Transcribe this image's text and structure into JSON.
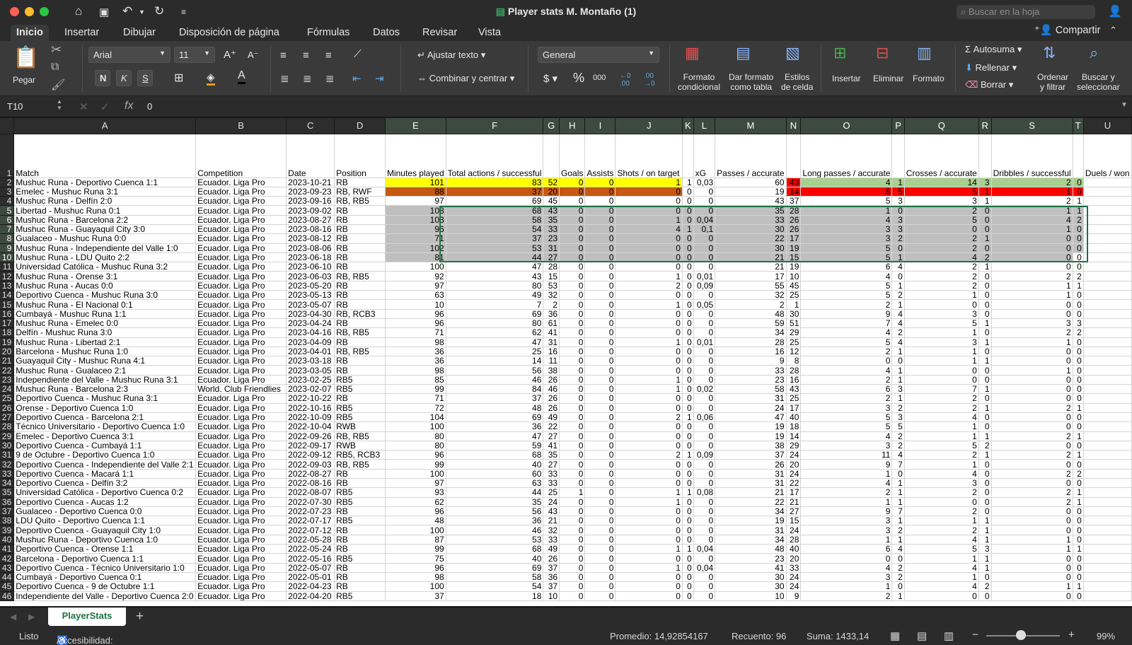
{
  "window": {
    "title": "Player stats M. Montaño (1)",
    "search_placeholder": "Buscar en la hoja"
  },
  "ribbon_tabs": [
    "Inicio",
    "Insertar",
    "Dibujar",
    "Disposición de página",
    "Fórmulas",
    "Datos",
    "Revisar",
    "Vista"
  ],
  "share": "Compartir",
  "ribbon": {
    "paste": "Pegar",
    "font": "Arial",
    "size": "11",
    "wrap": "Ajustar texto",
    "merge": "Combinar y centrar",
    "number_format": "General",
    "cond_format": [
      "Formato",
      "condicional"
    ],
    "format_table": [
      "Dar formato",
      "como tabla"
    ],
    "cell_styles": [
      "Estilos",
      "de celda"
    ],
    "insert": "Insertar",
    "delete": "Eliminar",
    "format": "Formato",
    "autosum": "Autosuma",
    "fill": "Rellenar",
    "clear": "Borrar",
    "sort": [
      "Ordenar",
      "y filtrar"
    ],
    "find": [
      "Buscar y",
      "seleccionar"
    ]
  },
  "formula_bar": {
    "cell": "T10",
    "value": "0"
  },
  "columns": [
    "A",
    "B",
    "C",
    "D",
    "E",
    "F",
    "G",
    "H",
    "I",
    "J",
    "K",
    "L",
    "M",
    "N",
    "O",
    "P",
    "Q",
    "R",
    "S",
    "T",
    "U"
  ],
  "header_row": [
    "Match",
    "Competition",
    "Date",
    "Position",
    "Minutes played",
    "Total actions / successful",
    "",
    "Goals",
    "Assists",
    "Shots / on target",
    "",
    "xG",
    "Passes / accurate",
    "",
    "Long passes / accurate",
    "",
    "Crosses / accurate",
    "",
    "Dribbles / successful",
    "",
    "Duels / won"
  ],
  "rows": [
    [
      "Mushuc Runa - Deportivo Cuenca 1:1",
      "Ecuador. Liga Pro",
      "2023-10-21",
      "RB",
      "101",
      "83",
      "52",
      "0",
      "0",
      "1",
      "1",
      "0,03",
      "60",
      "43",
      "4",
      "1",
      "14",
      "3",
      "2",
      "0"
    ],
    [
      "Emelec - Mushuc Runa 3:1",
      "Ecuador. Liga Pro",
      "2023-09-23",
      "RB, RWF",
      "88",
      "37",
      "20",
      "0",
      "0",
      "0",
      "0",
      "0",
      "19",
      "14",
      "6",
      "5",
      "5",
      "1",
      "1",
      "0"
    ],
    [
      "Mushuc Runa - Delfín 2:0",
      "Ecuador. Liga Pro",
      "2023-09-16",
      "RB, RB5",
      "97",
      "69",
      "45",
      "0",
      "0",
      "0",
      "0",
      "0",
      "43",
      "37",
      "5",
      "3",
      "3",
      "1",
      "2",
      "1"
    ],
    [
      "Libertad - Mushuc Runa 0:1",
      "Ecuador. Liga Pro",
      "2023-09-02",
      "RB",
      "108",
      "68",
      "43",
      "0",
      "0",
      "0",
      "0",
      "0",
      "35",
      "28",
      "1",
      "0",
      "2",
      "0",
      "1",
      "1"
    ],
    [
      "Mushuc Runa - Barcelona 2:2",
      "Ecuador. Liga Pro",
      "2023-08-27",
      "RB",
      "103",
      "58",
      "35",
      "0",
      "0",
      "1",
      "0",
      "0,04",
      "33",
      "26",
      "4",
      "3",
      "5",
      "0",
      "4",
      "2"
    ],
    [
      "Mushuc Runa - Guayaquil City 3:0",
      "Ecuador. Liga Pro",
      "2023-08-16",
      "RB",
      "96",
      "54",
      "33",
      "0",
      "0",
      "4",
      "1",
      "0,1",
      "30",
      "26",
      "3",
      "3",
      "0",
      "0",
      "1",
      "0"
    ],
    [
      "Gualaceo - Mushuc Runa 0:0",
      "Ecuador. Liga Pro",
      "2023-08-12",
      "RB",
      "71",
      "37",
      "23",
      "0",
      "0",
      "0",
      "0",
      "0",
      "22",
      "17",
      "3",
      "2",
      "2",
      "1",
      "0",
      "0"
    ],
    [
      "Mushuc Runa - Independiente del Valle 1:0",
      "Ecuador. Liga Pro",
      "2023-08-06",
      "RB",
      "102",
      "53",
      "31",
      "0",
      "0",
      "0",
      "0",
      "0",
      "30",
      "19",
      "5",
      "0",
      "2",
      "0",
      "0",
      "0"
    ],
    [
      "Mushuc Runa - LDU Quito 2:2",
      "Ecuador. Liga Pro",
      "2023-06-18",
      "RB",
      "81",
      "44",
      "27",
      "0",
      "0",
      "0",
      "0",
      "0",
      "21",
      "15",
      "5",
      "1",
      "4",
      "2",
      "0",
      "0"
    ],
    [
      "Universidad Católica - Mushuc Runa 3:2",
      "Ecuador. Liga Pro",
      "2023-06-10",
      "RB",
      "100",
      "47",
      "28",
      "0",
      "0",
      "0",
      "0",
      "0",
      "21",
      "19",
      "6",
      "4",
      "2",
      "1",
      "0",
      "0"
    ],
    [
      "Mushuc Runa - Orense 3:1",
      "Ecuador. Liga Pro",
      "2023-06-03",
      "RB, RB5",
      "92",
      "43",
      "15",
      "0",
      "0",
      "1",
      "0",
      "0,01",
      "17",
      "10",
      "4",
      "0",
      "2",
      "0",
      "2",
      "2"
    ],
    [
      "Mushuc Runa - Aucas 0:0",
      "Ecuador. Liga Pro",
      "2023-05-20",
      "RB",
      "97",
      "80",
      "53",
      "0",
      "0",
      "2",
      "0",
      "0,09",
      "55",
      "45",
      "5",
      "1",
      "2",
      "0",
      "1",
      "1"
    ],
    [
      "Deportivo Cuenca - Mushuc Runa 3:0",
      "Ecuador. Liga Pro",
      "2023-05-13",
      "RB",
      "63",
      "49",
      "32",
      "0",
      "0",
      "0",
      "0",
      "0",
      "32",
      "25",
      "5",
      "2",
      "1",
      "0",
      "1",
      "0"
    ],
    [
      "Mushuc Runa - El Nacional 0:1",
      "Ecuador. Liga Pro",
      "2023-05-07",
      "RB",
      "10",
      "7",
      "2",
      "0",
      "0",
      "1",
      "0",
      "0,05",
      "2",
      "1",
      "2",
      "1",
      "0",
      "0",
      "0",
      "0"
    ],
    [
      "Cumbayá - Mushuc Runa 1:1",
      "Ecuador. Liga Pro",
      "2023-04-30",
      "RB, RCB3",
      "96",
      "69",
      "36",
      "0",
      "0",
      "0",
      "0",
      "0",
      "48",
      "30",
      "9",
      "4",
      "3",
      "0",
      "0",
      "0"
    ],
    [
      "Mushuc Runa - Emelec 0:0",
      "Ecuador. Liga Pro",
      "2023-04-24",
      "RB",
      "96",
      "80",
      "61",
      "0",
      "0",
      "0",
      "0",
      "0",
      "59",
      "51",
      "7",
      "4",
      "5",
      "1",
      "3",
      "3"
    ],
    [
      "Delfín - Mushuc Runa 3:0",
      "Ecuador. Liga Pro",
      "2023-04-16",
      "RB, RB5",
      "71",
      "62",
      "41",
      "0",
      "0",
      "0",
      "0",
      "0",
      "34",
      "29",
      "4",
      "2",
      "1",
      "0",
      "2",
      "2"
    ],
    [
      "Mushuc Runa - Libertad 2:1",
      "Ecuador. Liga Pro",
      "2023-04-09",
      "RB",
      "98",
      "47",
      "31",
      "0",
      "0",
      "1",
      "0",
      "0,01",
      "28",
      "25",
      "5",
      "4",
      "3",
      "1",
      "1",
      "0"
    ],
    [
      "Barcelona - Mushuc Runa 1:0",
      "Ecuador. Liga Pro",
      "2023-04-01",
      "RB, RB5",
      "36",
      "25",
      "16",
      "0",
      "0",
      "0",
      "0",
      "0",
      "16",
      "12",
      "2",
      "1",
      "1",
      "0",
      "0",
      "0"
    ],
    [
      "Guayaquil City - Mushuc Runa 4:1",
      "Ecuador. Liga Pro",
      "2023-03-18",
      "RB",
      "36",
      "14",
      "11",
      "0",
      "0",
      "0",
      "0",
      "0",
      "9",
      "8",
      "0",
      "0",
      "1",
      "1",
      "0",
      "0"
    ],
    [
      "Mushuc Runa - Gualaceo 2:1",
      "Ecuador. Liga Pro",
      "2023-03-05",
      "RB",
      "98",
      "56",
      "38",
      "0",
      "0",
      "0",
      "0",
      "0",
      "33",
      "28",
      "4",
      "1",
      "0",
      "0",
      "1",
      "0"
    ],
    [
      "Independiente del Valle - Mushuc Runa 3:1",
      "Ecuador. Liga Pro",
      "2023-02-25",
      "RB5",
      "85",
      "46",
      "26",
      "0",
      "0",
      "1",
      "0",
      "0",
      "23",
      "16",
      "2",
      "1",
      "0",
      "0",
      "0",
      "0"
    ],
    [
      "Mushuc Runa - Barcelona 2:3",
      "World. Club Friendlies",
      "2023-02-07",
      "RB5",
      "99",
      "84",
      "46",
      "0",
      "0",
      "1",
      "0",
      "0,02",
      "58",
      "43",
      "6",
      "3",
      "7",
      "1",
      "0",
      "0"
    ],
    [
      "Deportivo Cuenca - Mushuc Runa 3:1",
      "Ecuador. Liga Pro",
      "2022-10-22",
      "RB",
      "71",
      "37",
      "26",
      "0",
      "0",
      "0",
      "0",
      "0",
      "31",
      "25",
      "2",
      "1",
      "2",
      "0",
      "0",
      "0"
    ],
    [
      "Orense - Deportivo Cuenca 1:0",
      "Ecuador. Liga Pro",
      "2022-10-16",
      "RB5",
      "72",
      "48",
      "26",
      "0",
      "0",
      "0",
      "0",
      "0",
      "24",
      "17",
      "3",
      "2",
      "2",
      "1",
      "2",
      "1"
    ],
    [
      "Deportivo Cuenca - Barcelona 2:1",
      "Ecuador. Liga Pro",
      "2022-10-09",
      "RB5",
      "104",
      "69",
      "49",
      "0",
      "0",
      "2",
      "1",
      "0,06",
      "47",
      "40",
      "5",
      "3",
      "4",
      "0",
      "0",
      "0"
    ],
    [
      "Técnico Universitario - Deportivo Cuenca 1:0",
      "Ecuador. Liga Pro",
      "2022-10-04",
      "RWB",
      "100",
      "36",
      "22",
      "0",
      "0",
      "0",
      "0",
      "0",
      "19",
      "18",
      "5",
      "5",
      "1",
      "0",
      "0",
      "0"
    ],
    [
      "Emelec - Deportivo Cuenca 3:1",
      "Ecuador. Liga Pro",
      "2022-09-26",
      "RB, RB5",
      "80",
      "47",
      "27",
      "0",
      "0",
      "0",
      "0",
      "0",
      "19",
      "14",
      "4",
      "2",
      "1",
      "1",
      "2",
      "1"
    ],
    [
      "Deportivo Cuenca - Cumbayá 1:1",
      "Ecuador. Liga Pro",
      "2022-09-17",
      "RWB",
      "80",
      "59",
      "41",
      "0",
      "0",
      "0",
      "0",
      "0",
      "38",
      "29",
      "3",
      "2",
      "5",
      "2",
      "0",
      "0"
    ],
    [
      "9 de Octubre - Deportivo Cuenca 1:0",
      "Ecuador. Liga Pro",
      "2022-09-12",
      "RB5, RCB3",
      "96",
      "68",
      "35",
      "0",
      "0",
      "2",
      "1",
      "0,09",
      "37",
      "24",
      "11",
      "4",
      "2",
      "1",
      "2",
      "1"
    ],
    [
      "Deportivo Cuenca - Independiente del Valle 2:1",
      "Ecuador. Liga Pro",
      "2022-09-03",
      "RB, RB5",
      "99",
      "40",
      "27",
      "0",
      "0",
      "0",
      "0",
      "0",
      "26",
      "20",
      "9",
      "7",
      "1",
      "0",
      "0",
      "0"
    ],
    [
      "Deportivo Cuenca - Macará 1:1",
      "Ecuador. Liga Pro",
      "2022-08-27",
      "RB",
      "100",
      "60",
      "33",
      "0",
      "0",
      "0",
      "0",
      "0",
      "31",
      "24",
      "1",
      "0",
      "4",
      "0",
      "2",
      "2"
    ],
    [
      "Deportivo Cuenca - Delfín 3:2",
      "Ecuador. Liga Pro",
      "2022-08-16",
      "RB",
      "97",
      "63",
      "33",
      "0",
      "0",
      "0",
      "0",
      "0",
      "31",
      "22",
      "4",
      "1",
      "3",
      "0",
      "0",
      "0"
    ],
    [
      "Universidad Católica - Deportivo Cuenca 0:2",
      "Ecuador. Liga Pro",
      "2022-08-07",
      "RB5",
      "93",
      "44",
      "25",
      "1",
      "0",
      "1",
      "1",
      "0,08",
      "21",
      "17",
      "2",
      "1",
      "2",
      "0",
      "2",
      "1"
    ],
    [
      "Deportivo Cuenca - Aucas 1:2",
      "Ecuador. Liga Pro",
      "2022-07-30",
      "RB5",
      "62",
      "35",
      "24",
      "0",
      "0",
      "1",
      "0",
      "0",
      "22",
      "21",
      "1",
      "1",
      "0",
      "0",
      "2",
      "1"
    ],
    [
      "Gualaceo - Deportivo Cuenca 0:0",
      "Ecuador. Liga Pro",
      "2022-07-23",
      "RB",
      "96",
      "56",
      "43",
      "0",
      "0",
      "0",
      "0",
      "0",
      "34",
      "27",
      "9",
      "7",
      "2",
      "0",
      "0",
      "0"
    ],
    [
      "LDU Quito - Deportivo Cuenca 1:1",
      "Ecuador. Liga Pro",
      "2022-07-17",
      "RB5",
      "48",
      "36",
      "21",
      "0",
      "0",
      "0",
      "0",
      "0",
      "19",
      "15",
      "3",
      "1",
      "1",
      "1",
      "0",
      "0"
    ],
    [
      "Deportivo Cuenca - Guayaquil City 1:0",
      "Ecuador. Liga Pro",
      "2022-07-12",
      "RB",
      "100",
      "46",
      "32",
      "0",
      "0",
      "0",
      "0",
      "0",
      "31",
      "24",
      "3",
      "2",
      "2",
      "1",
      "0",
      "0"
    ],
    [
      "Mushuc Runa - Deportivo Cuenca 1:0",
      "Ecuador. Liga Pro",
      "2022-05-28",
      "RB",
      "87",
      "53",
      "33",
      "0",
      "0",
      "0",
      "0",
      "0",
      "34",
      "28",
      "1",
      "1",
      "4",
      "1",
      "1",
      "0"
    ],
    [
      "Deportivo Cuenca - Orense 1:1",
      "Ecuador. Liga Pro",
      "2022-05-24",
      "RB",
      "99",
      "68",
      "49",
      "0",
      "0",
      "1",
      "1",
      "0,04",
      "48",
      "40",
      "6",
      "4",
      "5",
      "3",
      "1",
      "1"
    ],
    [
      "Barcelona - Deportivo Cuenca 1:1",
      "Ecuador. Liga Pro",
      "2022-05-16",
      "RB5",
      "75",
      "40",
      "26",
      "0",
      "0",
      "0",
      "0",
      "0",
      "23",
      "20",
      "0",
      "0",
      "1",
      "1",
      "0",
      "0"
    ],
    [
      "Deportivo Cuenca - Técnico Universitario 1:0",
      "Ecuador. Liga Pro",
      "2022-05-07",
      "RB",
      "96",
      "69",
      "37",
      "0",
      "0",
      "1",
      "0",
      "0,04",
      "41",
      "33",
      "4",
      "2",
      "4",
      "1",
      "0",
      "0"
    ],
    [
      "Cumbayá - Deportivo Cuenca 0:1",
      "Ecuador. Liga Pro",
      "2022-05-01",
      "RB",
      "98",
      "58",
      "36",
      "0",
      "0",
      "0",
      "0",
      "0",
      "30",
      "24",
      "3",
      "2",
      "1",
      "0",
      "0",
      "0"
    ],
    [
      "Deportivo Cuenca - 9 de Octubre 1:1",
      "Ecuador. Liga Pro",
      "2022-04-23",
      "RB",
      "100",
      "54",
      "37",
      "0",
      "0",
      "0",
      "0",
      "0",
      "30",
      "24",
      "1",
      "0",
      "4",
      "2",
      "1",
      "1"
    ],
    [
      "Independiente del Valle - Deportivo Cuenca 2:0",
      "Ecuador. Liga Pro",
      "2022-04-20",
      "RB5",
      "37",
      "18",
      "10",
      "0",
      "0",
      "0",
      "0",
      "0",
      "10",
      "9",
      "2",
      "1",
      "0",
      "0",
      "0",
      "0"
    ]
  ],
  "sheet_tab": "PlayerStats",
  "status": {
    "ready": "Listo",
    "accessibility": "Accesibilidad: todo correcto",
    "average": "Promedio: 14,92854167",
    "count": "Recuento: 96",
    "sum": "Suma: 1433,14",
    "zoom": "99%"
  },
  "colors": {
    "highlight_yellow": "#ffff00",
    "highlight_orange": "#c65911",
    "highlight_red": "#ff0000",
    "highlight_green": "#a9d08e",
    "selection_gray": "#bfbfbf",
    "accent_green": "#1e7145"
  }
}
